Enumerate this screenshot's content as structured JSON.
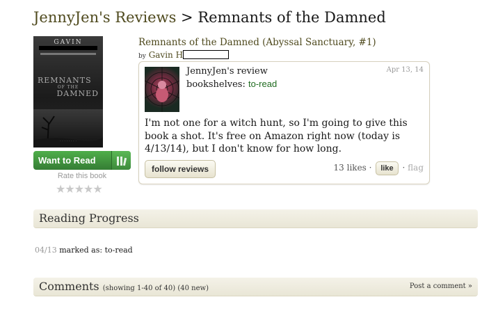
{
  "breadcrumb": {
    "site": "JennyJen's Reviews",
    "separator": ">",
    "book": "Remnants of the Damned"
  },
  "cover": {
    "author": "GAVIN",
    "title_line1": "REMNANTS",
    "title_line2": "OF THE",
    "title_line3": "DAMNED"
  },
  "want_to_read": {
    "label": "Want to Read"
  },
  "rating": {
    "label": "Rate this book",
    "stars": "★★★★★"
  },
  "book": {
    "title": "Remnants of the Damned (Abyssal Sanctuary, #1)",
    "by": "by",
    "author": "Gavin H"
  },
  "review": {
    "reviewer": "JennyJen's review",
    "shelves_label": "bookshelves:",
    "shelf": "to-read",
    "date": "Apr 13, 14",
    "text": "I'm not one for a witch hunt, so I'm going to give this book a shot. It's free on Amazon right now (today is 4/13/14), but I don't know for how long.",
    "follow_label": "follow reviews",
    "likes": "13 likes",
    "dot1": "·",
    "like_label": "like",
    "dot2": "·",
    "flag_label": "flag"
  },
  "reading_progress": {
    "heading": "Reading Progress",
    "date": "04/13",
    "status": "marked as: to-read"
  },
  "comments": {
    "heading": "Comments",
    "count": "(showing 1-40 of 40) (40 new)",
    "post_label": "Post a comment »"
  }
}
